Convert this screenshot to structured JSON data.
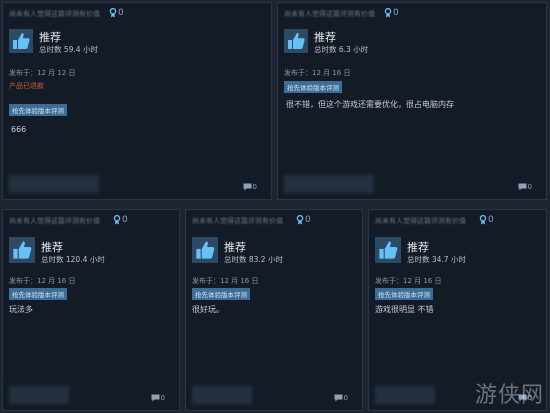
{
  "reviews": [
    {
      "helpful": "尚未有人觉得这篇评测有价值",
      "awards": "0",
      "recommendation": "推荐",
      "hours": "总时数 59.4 小时",
      "posted": "发布于：12 月 12 日",
      "refund": "产品已退款",
      "badge": "抢先体验版本评测",
      "text": "666",
      "comments": "0"
    },
    {
      "helpful": "尚未有人觉得这篇评测有价值",
      "awards": "0",
      "recommendation": "推荐",
      "hours": "总时数 6.3 小时",
      "posted": "发布于：12 月 16 日",
      "badge": "抢先体验版本评测",
      "text": "很不错，但这个游戏还需要优化，很占电脑内存",
      "comments": "0"
    },
    {
      "helpful": "尚未有人觉得这篇评测有价值",
      "awards": "0",
      "recommendation": "推荐",
      "hours": "总时数 120.4 小时",
      "posted": "发布于：12 月 16 日",
      "badge": "抢先体验版本评测",
      "text": "玩法多",
      "comments": "0"
    },
    {
      "helpful": "尚未有人觉得这篇评测有价值",
      "awards": "0",
      "recommendation": "推荐",
      "hours": "总时数 83.2 小时",
      "posted": "发布于：12 月 16 日",
      "badge": "抢先体验版本评测",
      "text": "很好玩。",
      "comments": "0"
    },
    {
      "helpful": "尚未有人觉得这篇评测有价值",
      "awards": "0",
      "recommendation": "推荐",
      "hours": "总时数 34.7 小时",
      "posted": "发布于：12 月 16 日",
      "badge": "抢先体验版本评测",
      "text": "游戏很明显 不错",
      "comments": "0"
    }
  ],
  "watermark": "游侠网",
  "icons": {
    "thumb": "thumbs-up-icon",
    "award": "award-ribbon-icon",
    "comment": "comment-bubble-icon"
  },
  "colors": {
    "background": "#1e2530",
    "card": "#131b26",
    "badge": "#3b6d96",
    "refund": "#d05a2b",
    "thumb_icon": "#67c1f5"
  }
}
